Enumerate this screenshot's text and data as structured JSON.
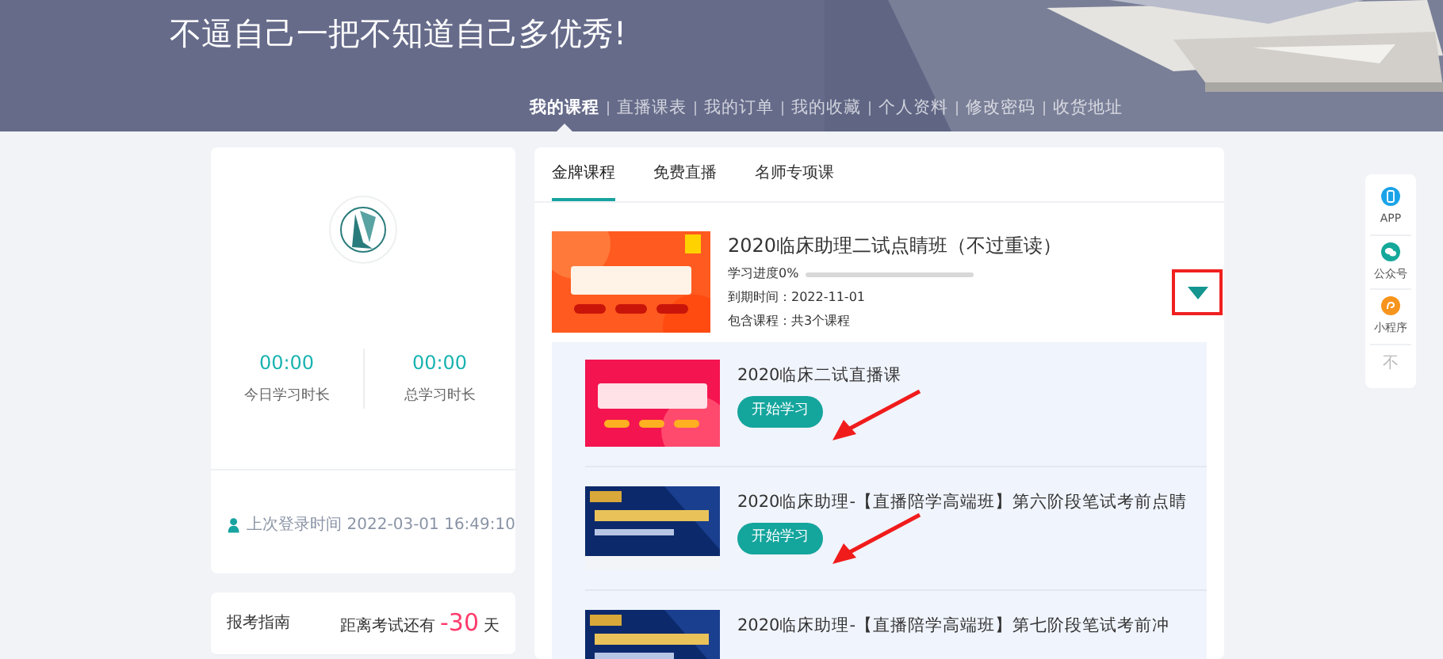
{
  "banner": {
    "slogan": "不逼自己一把不知道自己多优秀!"
  },
  "nav": [
    {
      "label": "我的课程",
      "selected": true
    },
    {
      "label": "直播课表",
      "selected": false
    },
    {
      "label": "我的订单",
      "selected": false
    },
    {
      "label": "我的收藏",
      "selected": false
    },
    {
      "label": "个人资料",
      "selected": false
    },
    {
      "label": "修改密码",
      "selected": false
    },
    {
      "label": "收货地址",
      "selected": false
    }
  ],
  "profile": {
    "stats": [
      {
        "value": "00:00",
        "label": "今日学习时长"
      },
      {
        "value": "00:00",
        "label": "总学习时长"
      }
    ],
    "last_login": "上次登录时间 2022-03-01 16:49:10"
  },
  "exam_guide": {
    "title": "报考指南",
    "countdown_prefix": "距离考试还有",
    "countdown_days": "-30",
    "countdown_unit": "天"
  },
  "tabs": [
    {
      "label": "金牌课程",
      "selected": true
    },
    {
      "label": "免费直播",
      "selected": false
    },
    {
      "label": "名师专项课",
      "selected": false
    }
  ],
  "course": {
    "title": "2020临床助理二试点睛班（不过重读）",
    "progress_label": "学习进度0%",
    "level": 0,
    "expiry": "到期时间：2022-11-01",
    "includes": "包含课程：共3个课程",
    "expanded": true,
    "lessons": [
      {
        "title": "2020临床二试直播课",
        "button": "开始学习",
        "annotated": true
      },
      {
        "title": "2020临床助理-【直播陪学高端班】第六阶段笔试考前点睛",
        "button": "开始学习",
        "annotated": true
      },
      {
        "title": "2020临床助理-【直播陪学高端班】第七阶段笔试考前冲",
        "annotated": false
      }
    ]
  },
  "side_tools": [
    {
      "label": "APP",
      "kind": "phone",
      "color": "#1aa3e8"
    },
    {
      "label": "公众号",
      "kind": "chat",
      "color": "#14a89a"
    },
    {
      "label": "小程序",
      "kind": "mini",
      "color": "#f7941d"
    },
    {
      "label": "不",
      "kind": "top"
    }
  ]
}
